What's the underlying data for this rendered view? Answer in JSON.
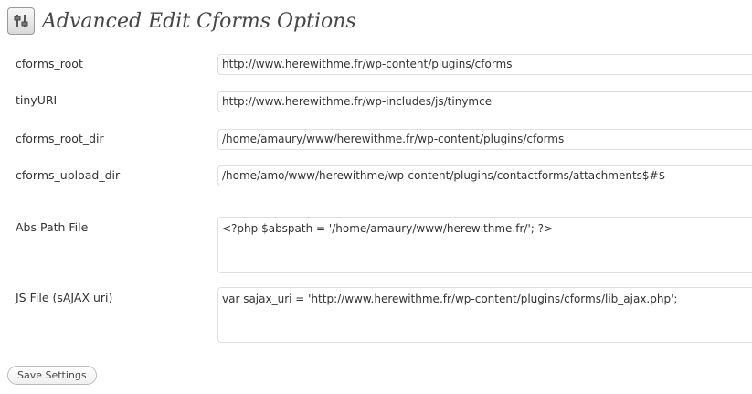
{
  "header": {
    "title": "Advanced Edit Cforms Options",
    "icon": "settings-sliders-icon"
  },
  "fields": [
    {
      "label": "cforms_root",
      "value": "http://www.herewithme.fr/wp-content/plugins/cforms"
    },
    {
      "label": "tinyURI",
      "value": "http://www.herewithme.fr/wp-includes/js/tinymce"
    },
    {
      "label": "cforms_root_dir",
      "value": "/home/amaury/www/herewithme.fr/wp-content/plugins/cforms"
    },
    {
      "label": "cforms_upload_dir",
      "value": "/home/amo/www/herewithme/wp-content/plugins/contactforms/attachments$#$"
    },
    {
      "label": "Abs Path File",
      "value": "<?php $abspath = '/home/amaury/www/herewithme.fr/'; ?>"
    },
    {
      "label": "JS File (sAJAX uri)",
      "value": "var sajax_uri = 'http://www.herewithme.fr/wp-content/plugins/cforms/lib_ajax.php';"
    }
  ],
  "actions": {
    "save_label": "Save Settings"
  }
}
